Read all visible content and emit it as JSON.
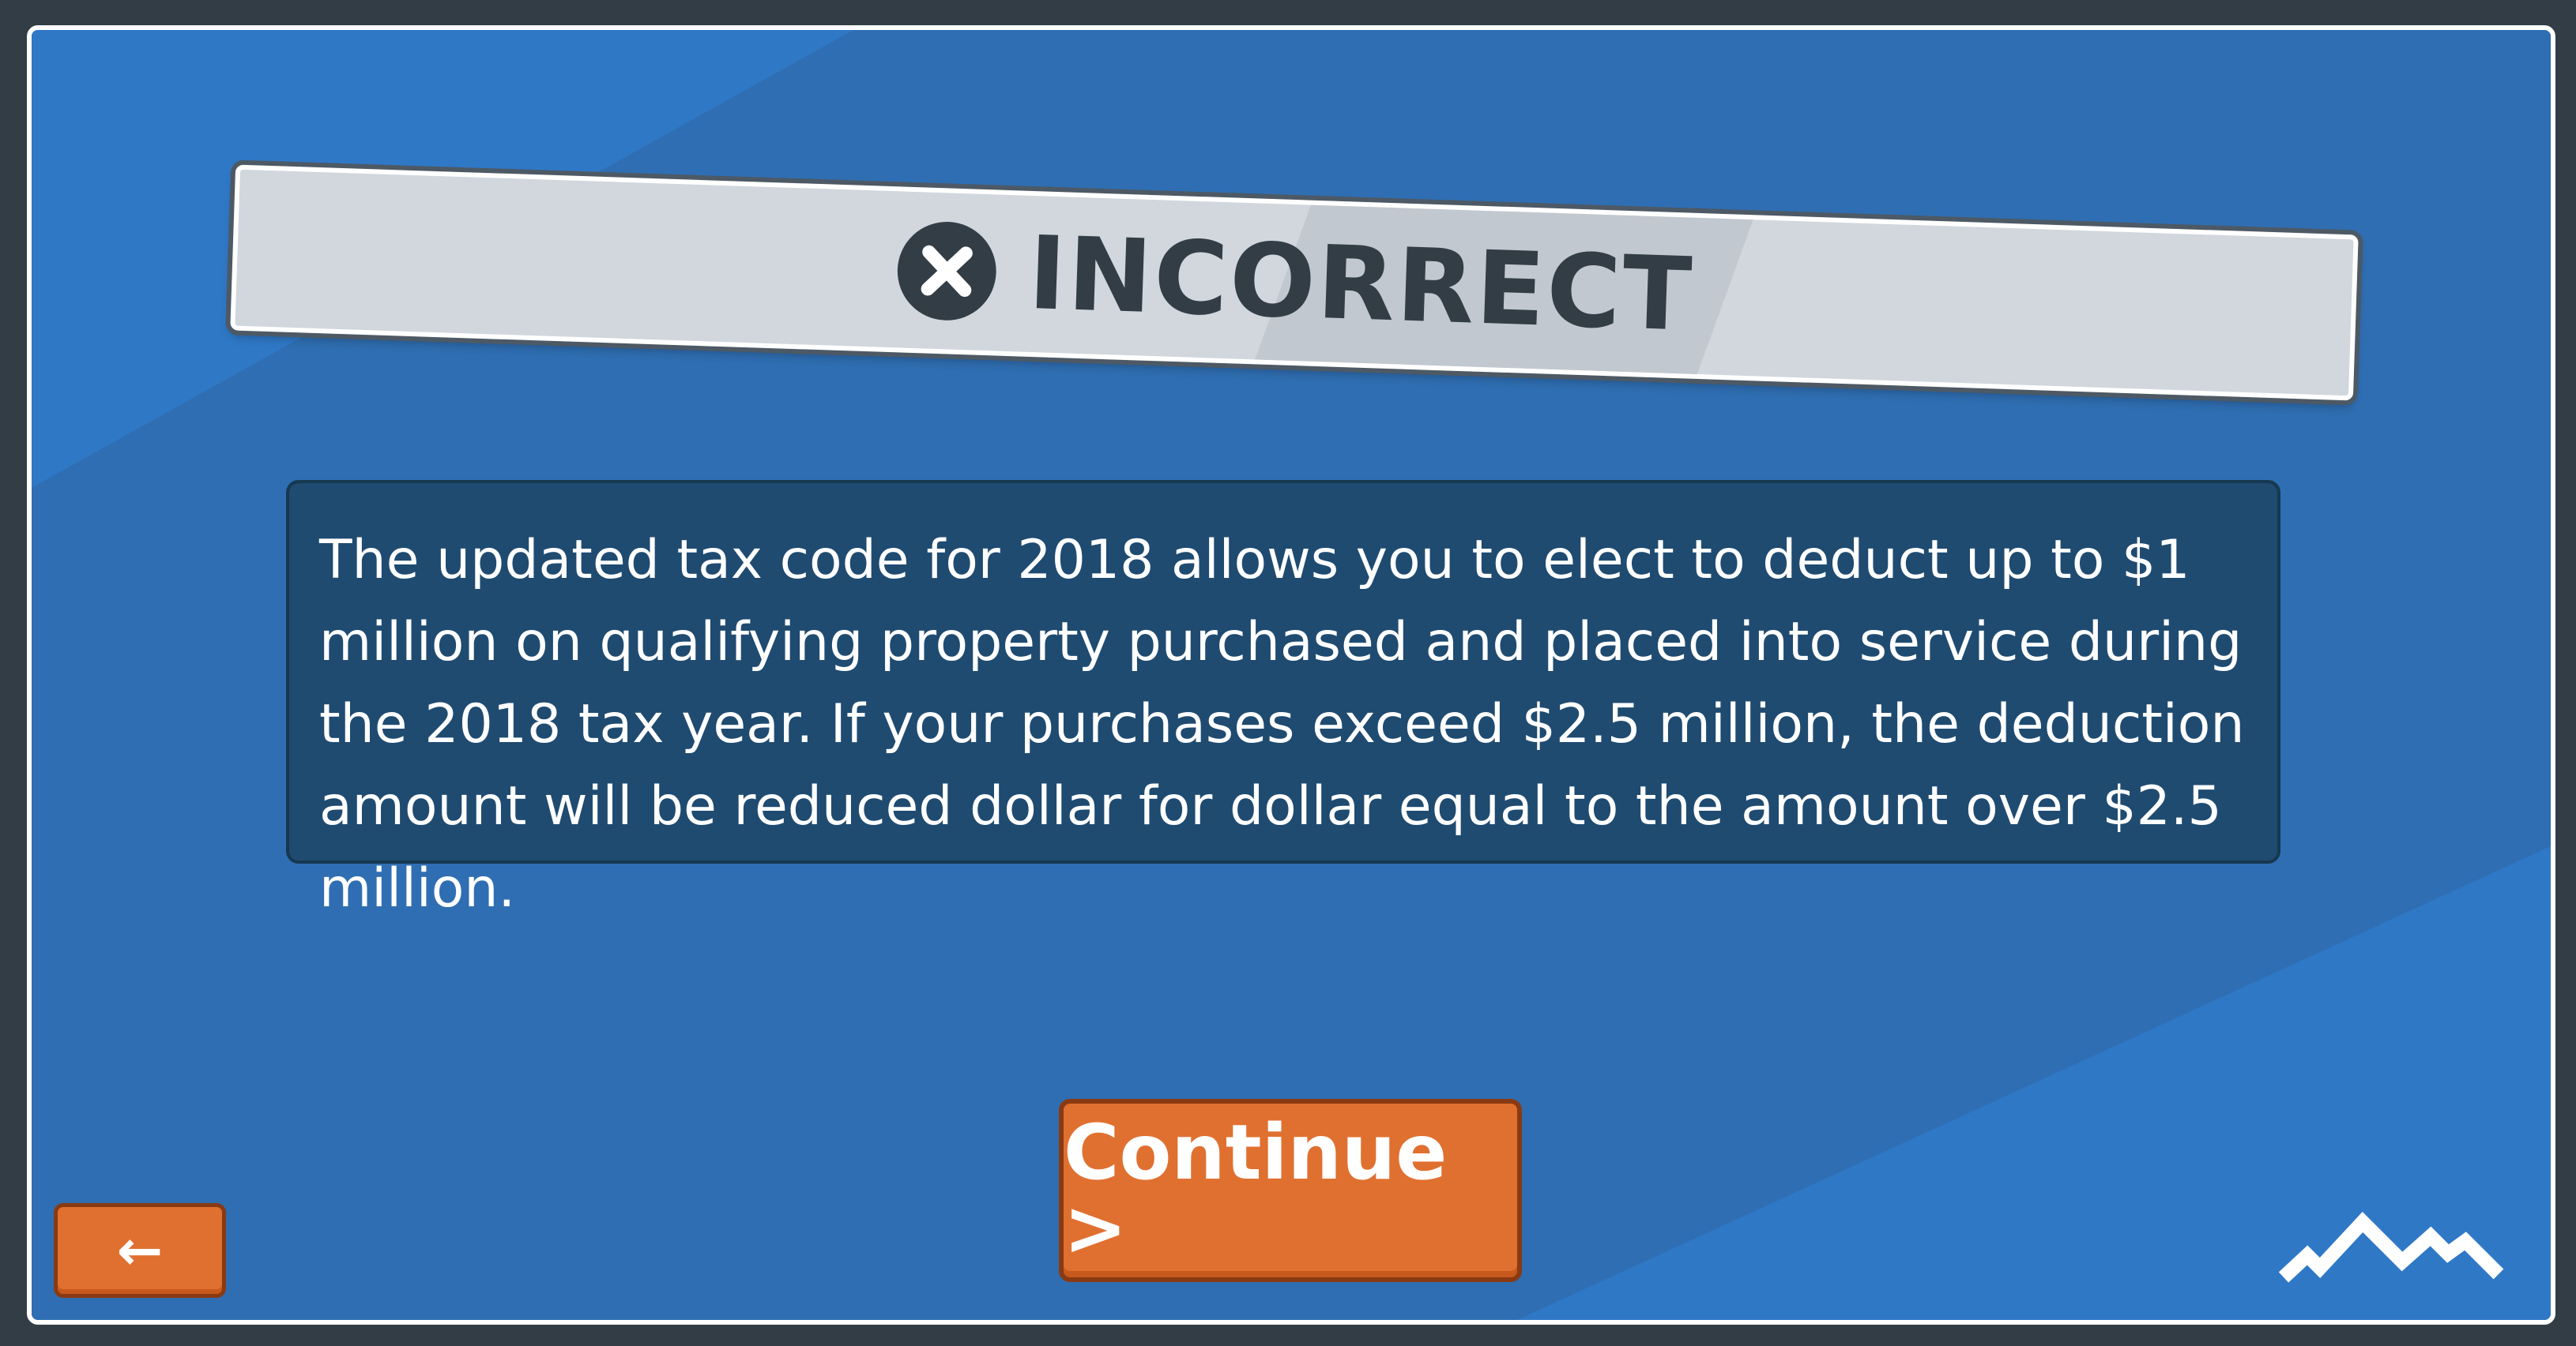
{
  "feedback": {
    "status": "INCORRECT",
    "status_icon": "x-circle-icon",
    "message": "The updated tax code for 2018 allows you to elect to deduct up to $1 million on qualifying property purchased and placed into service during the 2018 tax year. If your purchases exceed $2.5 million, the deduction amount will be reduced dollar for dollar equal to the amount over $2.5 million."
  },
  "buttons": {
    "continue_label": "Continue >",
    "back_label": "←"
  },
  "logo": {
    "icon": "mountain-logo-icon"
  },
  "colors": {
    "background": "#2f6eb2",
    "accent": "#e07030",
    "banner": "#d1d7dd",
    "message_box": "#1f4b71",
    "dark": "#333d45"
  }
}
